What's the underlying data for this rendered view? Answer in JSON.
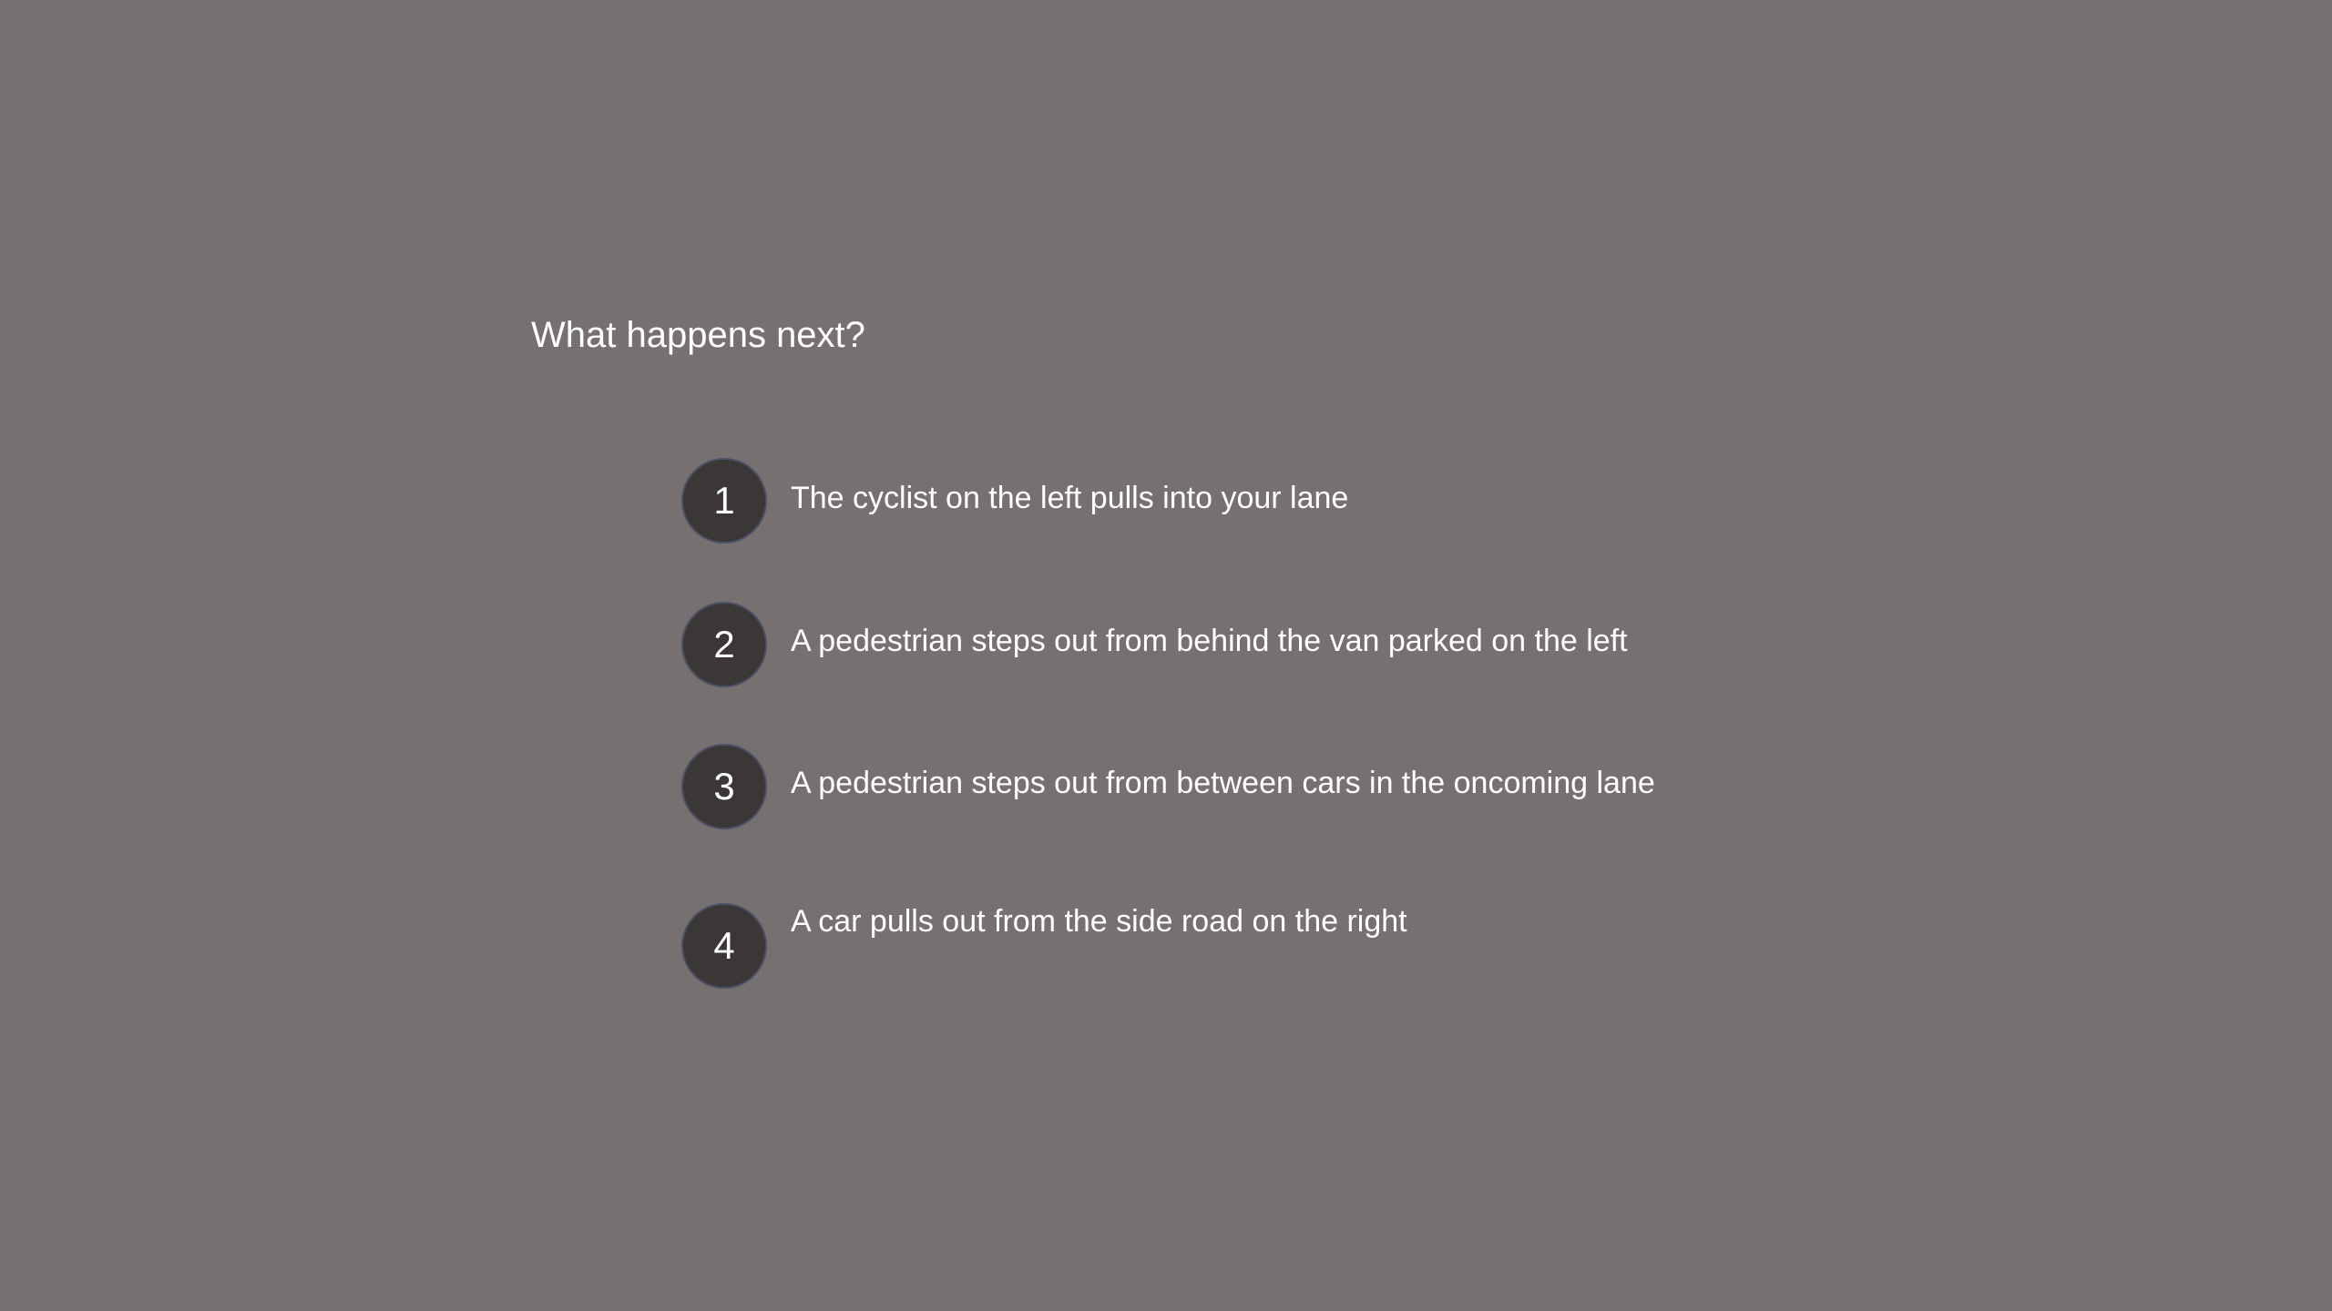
{
  "question": {
    "text": "What happens next?"
  },
  "options": [
    {
      "number": "1",
      "text": "The cyclist on the left pulls into your lane"
    },
    {
      "number": "2",
      "text": "A pedestrian steps out from behind the van parked on the left"
    },
    {
      "number": "3",
      "text": "A pedestrian steps out from between cars in the oncoming lane"
    },
    {
      "number": "4",
      "text": "A car pulls out from the side road on the right"
    }
  ],
  "colors": {
    "background": "#767070",
    "badge_fill": "#3b3736",
    "badge_border": "#4a5066",
    "text": "#ffffff"
  }
}
